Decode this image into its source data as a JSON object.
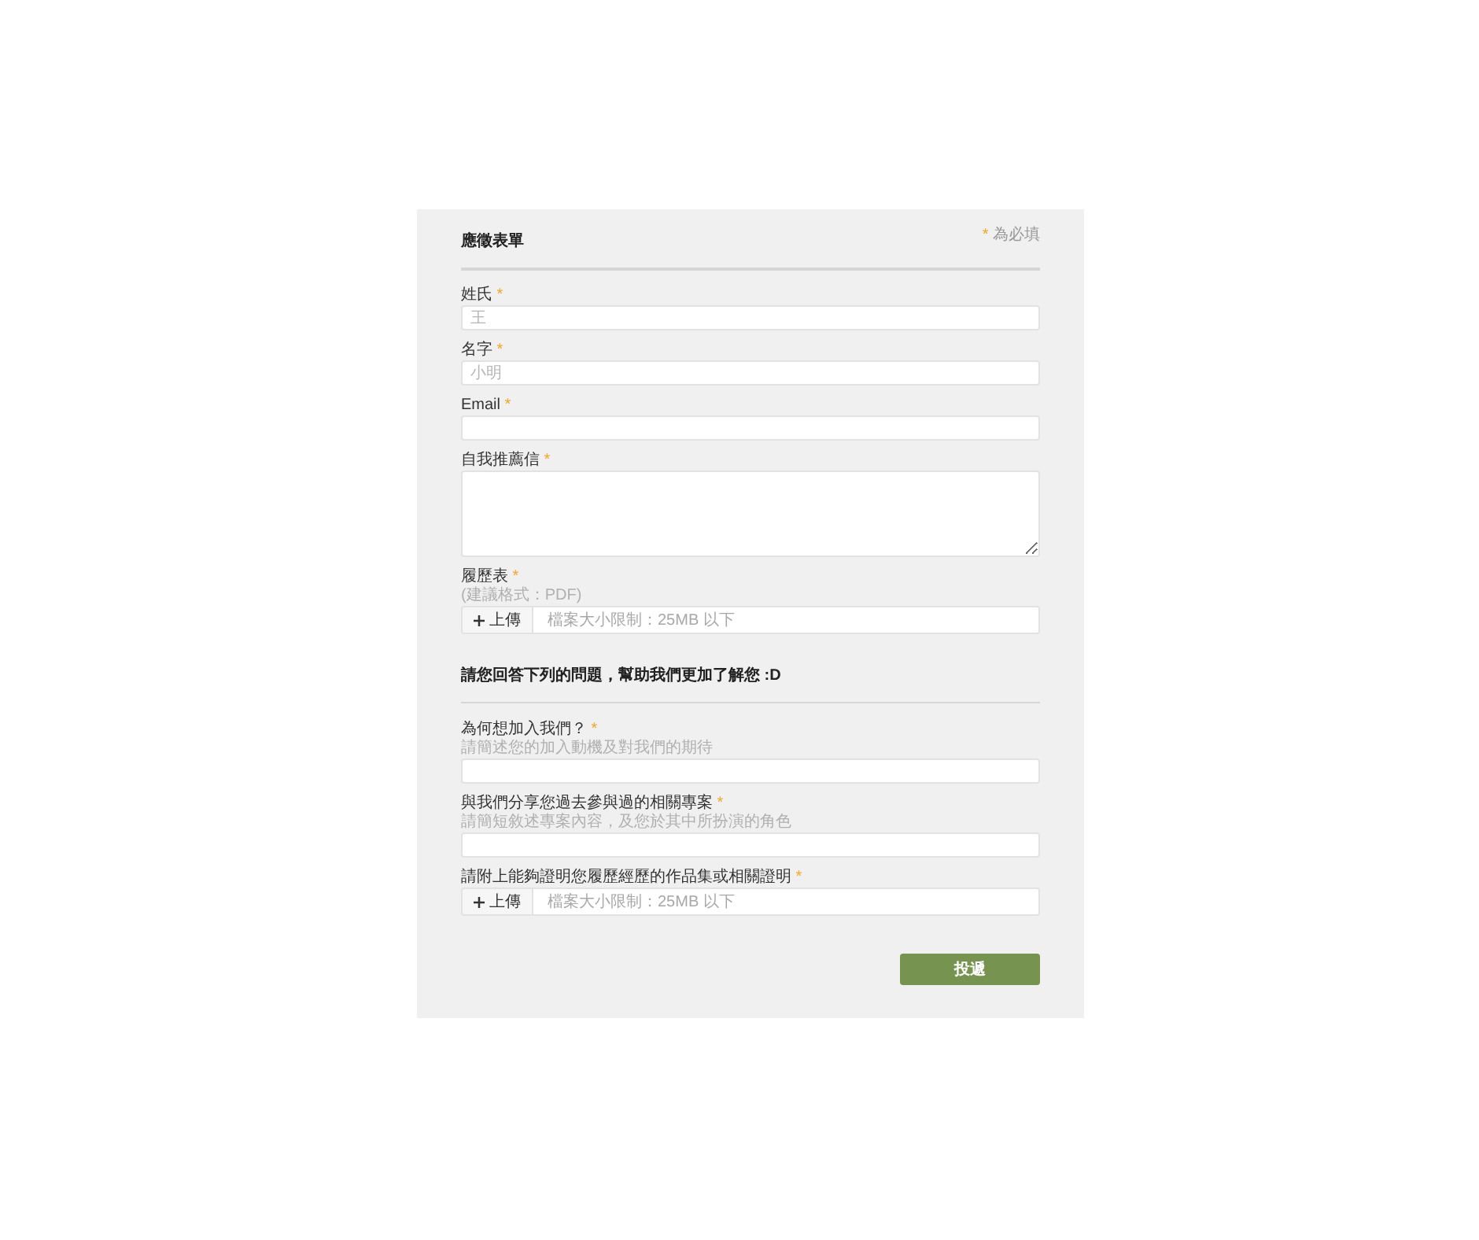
{
  "form": {
    "title": "應徵表單",
    "legend": {
      "mark": "*",
      "text": "為必填"
    },
    "fields": [
      {
        "kind": "text",
        "label": "姓氏",
        "required_mark": "*",
        "placeholder": "王"
      },
      {
        "kind": "text",
        "label": "名字",
        "required_mark": "*",
        "placeholder": "小明"
      },
      {
        "kind": "text",
        "label": "Email",
        "required_mark": "*"
      },
      {
        "kind": "textarea",
        "label": "自我推薦信",
        "required_mark": "*"
      },
      {
        "kind": "file",
        "label": "履歷表",
        "required_mark": "*",
        "hint": "(建議格式：PDF)",
        "button": "上傳",
        "placeholder": "檔案大小限制：25MB 以下"
      }
    ]
  },
  "questions": {
    "title": "請您回答下列的問題，幫助我們更加了解您 :D",
    "fields": [
      {
        "kind": "text",
        "label": "為何想加入我們？",
        "required_mark": "*",
        "hint": "請簡述您的加入動機及對我們的期待"
      },
      {
        "kind": "text",
        "label": "與我們分享您過去參與過的相關專案",
        "required_mark": "*",
        "hint": "請簡短敘述專案內容，及您於其中所扮演的角色"
      },
      {
        "kind": "file",
        "label": "請附上能夠證明您履歷經歷的作品集或相關證明",
        "required_mark": "*",
        "button": "上傳",
        "placeholder": "檔案大小限制：25MB 以下"
      }
    ]
  },
  "submit": {
    "label": "投遞"
  }
}
